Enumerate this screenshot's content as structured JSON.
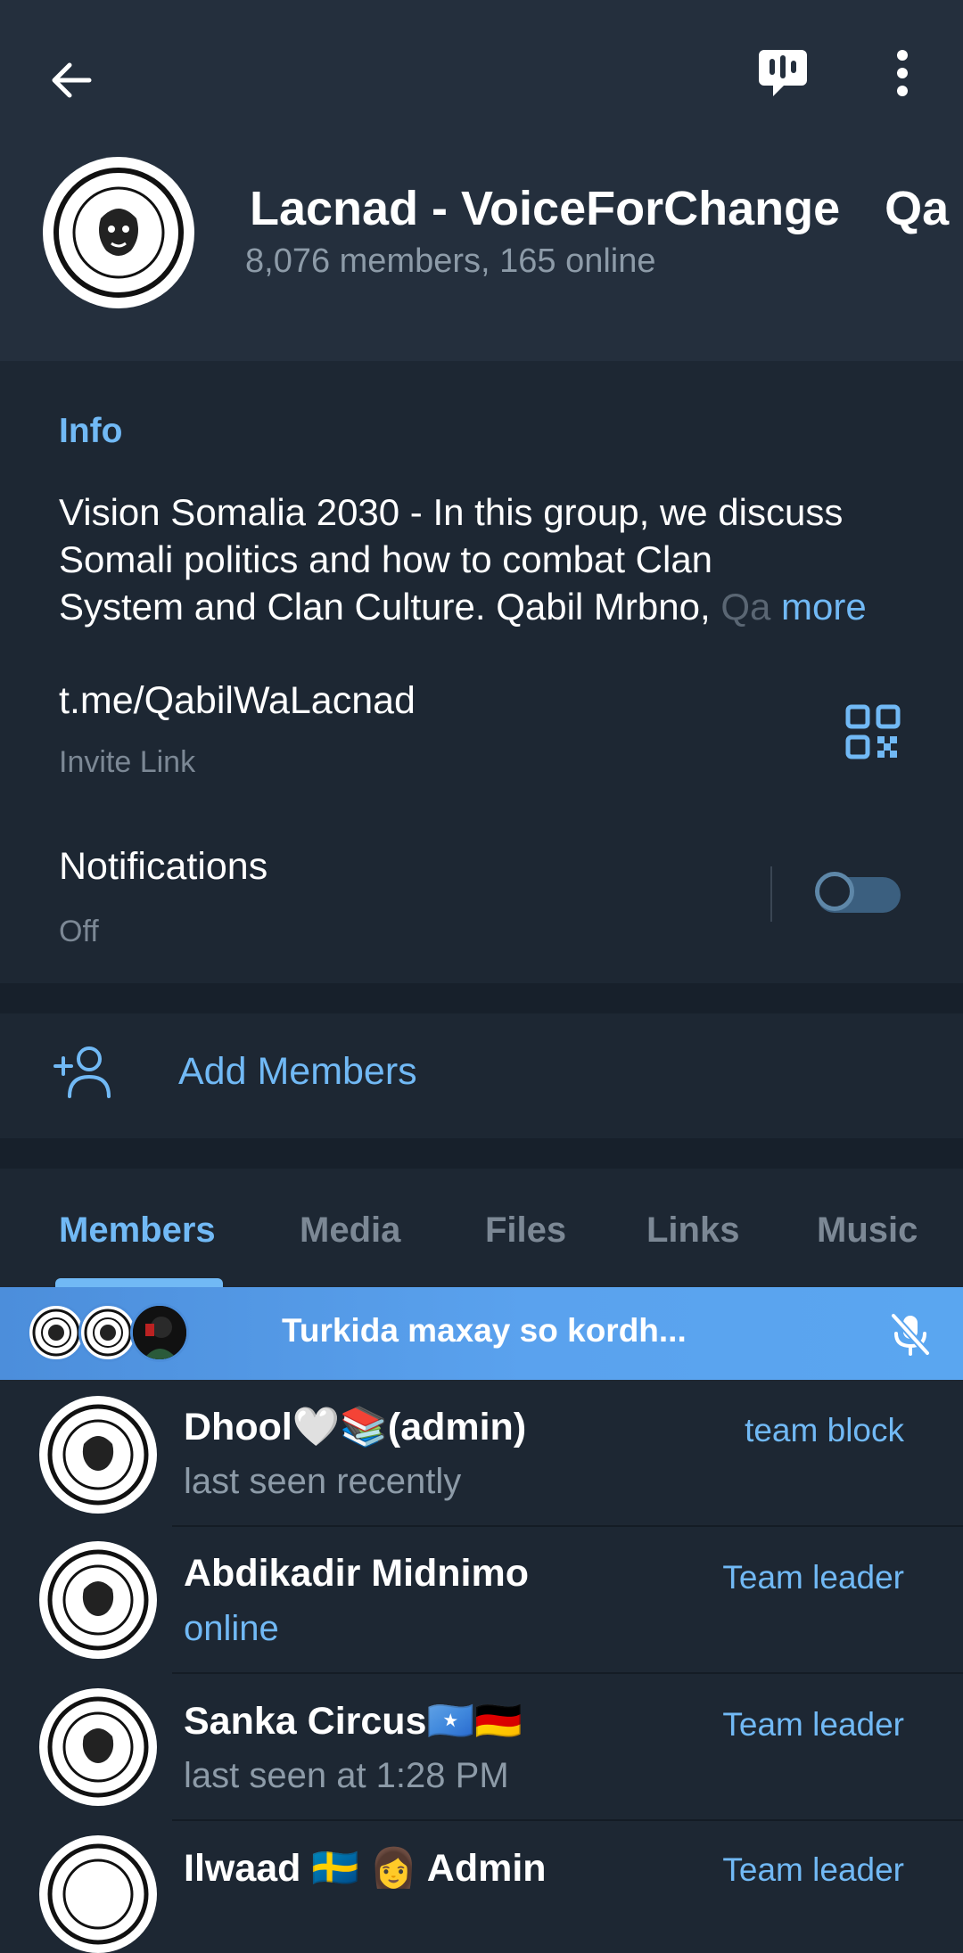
{
  "header": {
    "title": "Lacnad - VoiceForChange",
    "title_overflow": "Qa",
    "subtitle": "8,076 members, 165 online"
  },
  "info": {
    "label": "Info",
    "description_line1": "Vision Somalia 2030 - In this group, we discuss",
    "description_line2": "Somali politics and how to combat Clan",
    "description_line3": "System and Clan Culture. Qabil Mrbno, ",
    "description_fade": "Qa",
    "more_label": "more",
    "invite_link": "t.me/QabilWaLacnad",
    "invite_label": "Invite Link",
    "notifications_label": "Notifications",
    "notifications_status": "Off"
  },
  "add_members": {
    "label": "Add Members"
  },
  "tabs": [
    {
      "label": "Members",
      "active": true
    },
    {
      "label": "Media"
    },
    {
      "label": "Files"
    },
    {
      "label": "Links"
    },
    {
      "label": "Music"
    }
  ],
  "voice_chat": {
    "title": "Turkida maxay so kordh..."
  },
  "members": [
    {
      "name": "Dhool🤍📚(admin)",
      "status": "last seen recently",
      "role": "team block",
      "online": false
    },
    {
      "name": "Abdikadir Midnimo",
      "status": "online",
      "role": "Team leader",
      "online": true
    },
    {
      "name": "Sanka Circus🇸🇴🇩🇪",
      "status": "last seen at 1:28 PM",
      "role": "Team leader",
      "online": false
    },
    {
      "name": "Ilwaad 🇸🇪 👩 Admin",
      "status": "",
      "role": "Team leader",
      "online": false
    }
  ],
  "colors": {
    "accent": "#71b9f5",
    "header_bg": "#242f3d",
    "card_bg": "#1d2733",
    "voice_chat_bg": "#5aa2ee"
  }
}
